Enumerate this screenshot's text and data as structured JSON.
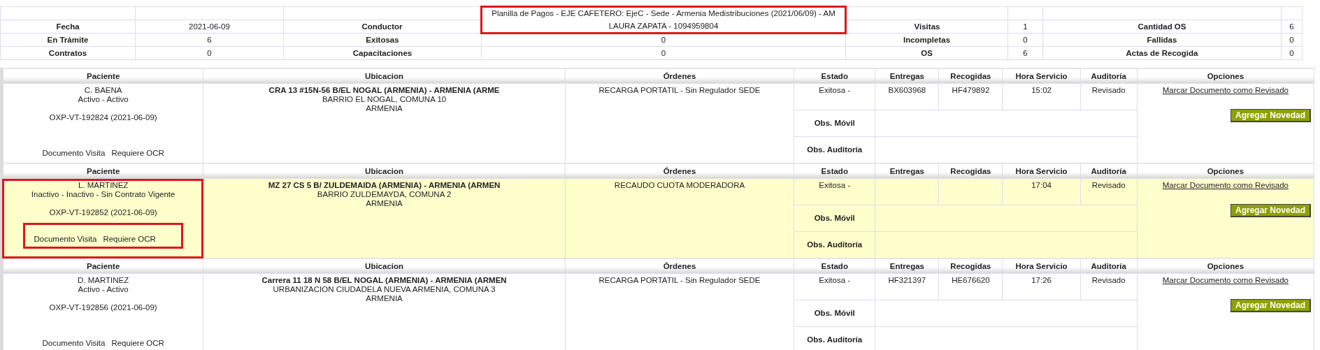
{
  "summary": {
    "title": "Planilla de Pagos - EJE CAFETERO: EjeC - Sede - Armenia Medistribuciones (2021/06/09) - AM",
    "framed": true,
    "rows": [
      [
        {
          "label": "Fecha",
          "value": "2021-06-09"
        },
        {
          "label": "Conductor",
          "value": "LAURA ZAPATA - 1094959804",
          "framed": true
        },
        {
          "label": "Visitas",
          "value": "1"
        },
        {
          "label": "Cantidad OS",
          "value": "6"
        }
      ],
      [
        {
          "label": "En Trámite",
          "value": "6"
        },
        {
          "label": "Exitosas",
          "value": "0"
        },
        {
          "label": "Incompletas",
          "value": "0"
        },
        {
          "label": "Fallidas",
          "value": "0"
        }
      ],
      [
        {
          "label": "Contratos",
          "value": "0"
        },
        {
          "label": "Capacitaciones",
          "value": "0"
        },
        {
          "label": "OS",
          "value": "6"
        },
        {
          "label": "Actas de Recogida",
          "value": "0"
        }
      ]
    ]
  },
  "records": [
    {
      "highlighted": false,
      "columns": [
        "Paciente",
        "Ubicacion",
        "Órdenes",
        "Estado",
        "Entregas",
        "Recogidas",
        "Hora Servicio",
        "Auditoría",
        "Opciones"
      ],
      "patient": {
        "name": "C. BAENA",
        "status": "Activo - Activo",
        "code": "OXP-VT-192824 (2021-06-09)",
        "framed": false
      },
      "documents": {
        "items": [
          "Documento Visita",
          "Requiere OCR"
        ],
        "framed": false
      },
      "address": [
        "CRA 13 #15N-56 B/EL NOGAL (ARMENIA) - ARMENIA (ARME",
        "BARRIO EL NOGAL, COMUNA 10",
        "ARMENIA"
      ],
      "orders": "RECARGA PORTATIL - Sin Regulador SEDE",
      "estado": "Exitosa -",
      "entregas": "BX603968",
      "recogidas": "HF479892",
      "hora": "15:02",
      "auditoria": "Revisado",
      "link": "Marcar Documento como Revisado",
      "button": "Agregar Novedad",
      "obs": [
        "Obs. Móvil",
        "Obs. Auditoría"
      ]
    },
    {
      "highlighted": true,
      "columns": [
        "Paciente",
        "Ubicacion",
        "Órdenes",
        "Estado",
        "Entregas",
        "Recogidas",
        "Hora Servicio",
        "Auditoría",
        "Opciones"
      ],
      "patient": {
        "name": "L. MARTINEZ",
        "status": "Inactivo - Inactivo - Sin Contrato Vigente",
        "code": "OXP-VT-192852 (2021-06-09)",
        "framed": true
      },
      "documents": {
        "items": [
          "Documento Visita",
          "Requiere OCR"
        ],
        "framed": true
      },
      "address": [
        "MZ 27 CS 5 B/ ZULDEMAIDA (ARMENIA) - ARMENIA (ARMEN",
        "BARRIO ZULDEMAYDA, COMUNA 2",
        "ARMENIA"
      ],
      "orders": "RECAUDO CUOTA MODERADORA",
      "estado": "Exitosa -",
      "hora": "17:04",
      "auditoria": "Revisado",
      "link": "Marcar Documento como Revisado",
      "button": "Agregar Novedad",
      "obs": [
        "Obs. Móvil",
        "Obs. Auditoría"
      ]
    },
    {
      "highlighted": false,
      "columns": [
        "Paciente",
        "Ubicacion",
        "Órdenes",
        "Estado",
        "Entregas",
        "Recogidas",
        "Hora Servicio",
        "Auditoría",
        "Opciones"
      ],
      "patient": {
        "name": "D. MARTINEZ",
        "status": "Activo - Activo",
        "code": "OXP-VT-192856 (2021-06-09)",
        "framed": false
      },
      "documents": {
        "items": [
          "Documento Visita",
          "Requiere OCR"
        ],
        "framed": false
      },
      "address": [
        "Carrera 11 18 N 58 B/EL NOGAL (ARMENIA) - ARMENIA (ARMEN",
        "URBANIZACION CIUDADELA NUEVA ARMENIA, COMUNA 3",
        "ARMENIA"
      ],
      "orders": "RECARGA PORTATIL - Sin Regulador SEDE",
      "estado": "Exitosa -",
      "entregas": "HF321397",
      "recogidas": "HE676620",
      "hora": "17:26",
      "auditoria": "Revisado",
      "link": "Marcar Documento como Revisado",
      "button": "Agregar Novedad",
      "obs": [
        "Obs. Móvil",
        "Obs. Auditoría"
      ]
    }
  ]
}
